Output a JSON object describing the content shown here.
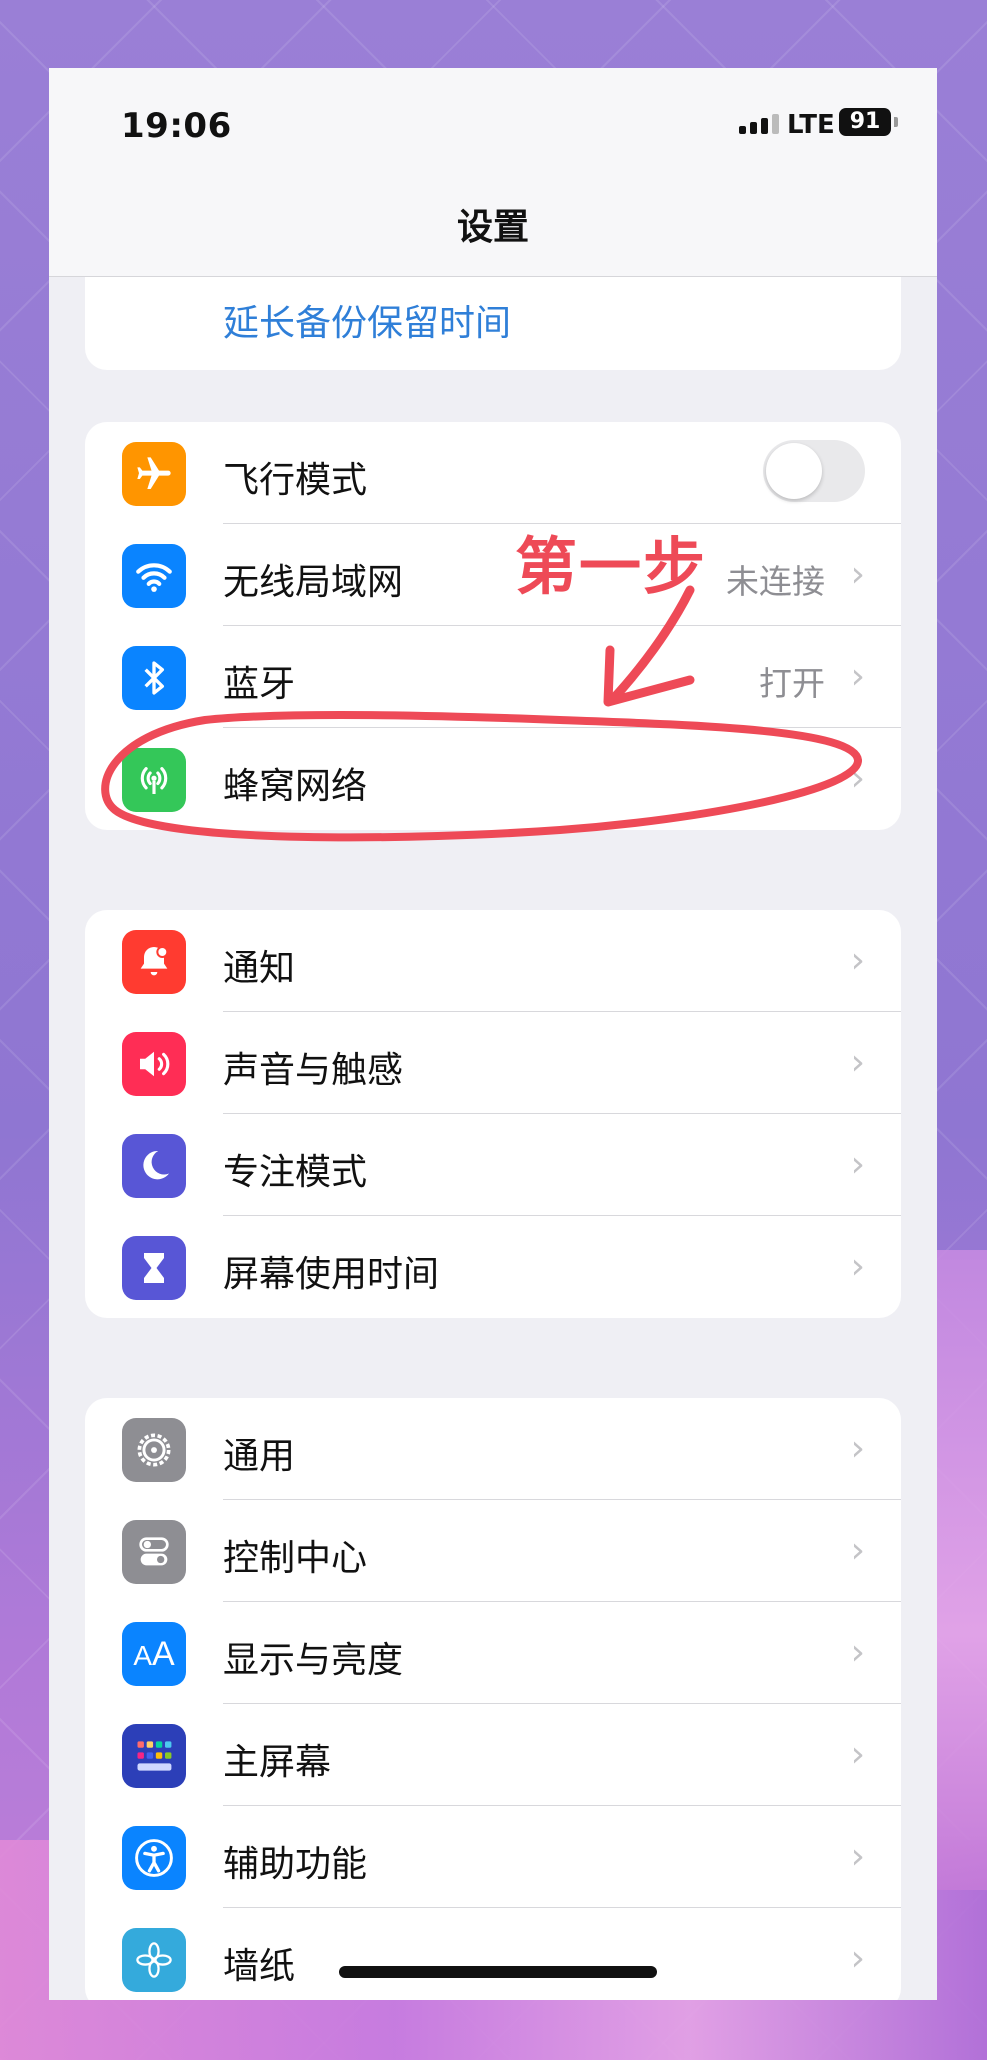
{
  "status_bar": {
    "time": "19:06",
    "network": "LTE",
    "battery": "91"
  },
  "nav": {
    "title": "设置"
  },
  "backup_link": "延长备份保留时间",
  "group1": [
    {
      "label": "飞行模式",
      "icon": "airplane-icon",
      "color": "#ff9500",
      "control": "toggle-off"
    },
    {
      "label": "无线局域网",
      "icon": "wifi-icon",
      "color": "#0a84ff",
      "value": "未连接"
    },
    {
      "label": "蓝牙",
      "icon": "bluetooth-icon",
      "color": "#0a84ff",
      "value": "打开"
    },
    {
      "label": "蜂窝网络",
      "icon": "cellular-icon",
      "color": "#34c759",
      "value": ""
    }
  ],
  "group2": [
    {
      "label": "通知",
      "icon": "notification-icon",
      "color": "#ff3b30"
    },
    {
      "label": "声音与触感",
      "icon": "sound-icon",
      "color": "#ff2d55"
    },
    {
      "label": "专注模式",
      "icon": "moon-icon",
      "color": "#5856d6"
    },
    {
      "label": "屏幕使用时间",
      "icon": "hourglass-icon",
      "color": "#5856d6"
    }
  ],
  "group3": [
    {
      "label": "通用",
      "icon": "gear-icon",
      "color": "#8e8e93"
    },
    {
      "label": "控制中心",
      "icon": "control-center-icon",
      "color": "#8e8e93"
    },
    {
      "label": "显示与亮度",
      "icon": "display-icon",
      "color": "#0a84ff"
    },
    {
      "label": "主屏幕",
      "icon": "home-screen-icon",
      "color": "#2c3fb8"
    },
    {
      "label": "辅助功能",
      "icon": "accessibility-icon",
      "color": "#0a84ff"
    },
    {
      "label": "墙纸",
      "icon": "wallpaper-icon",
      "color": "#34aadc"
    }
  ],
  "annotation": {
    "text": "第一步",
    "color": "#ee4a57"
  }
}
